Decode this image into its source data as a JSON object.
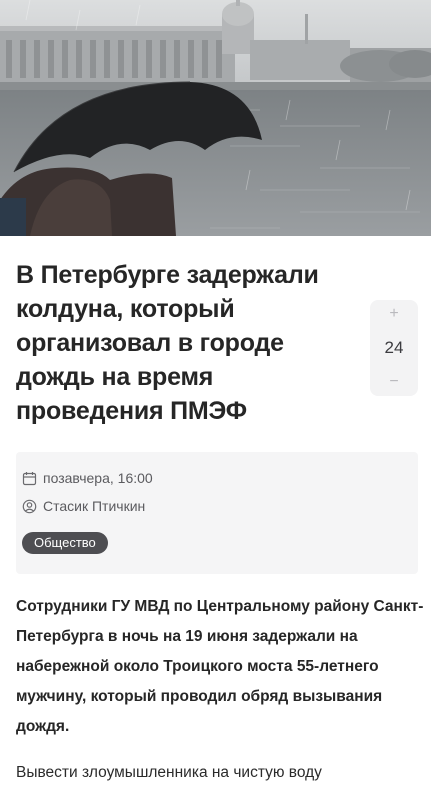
{
  "article": {
    "title": "В Петербурге задержали колдуна, который организовал в городе дождь на время проведения ПМЭФ",
    "date": "позавчера, 16:00",
    "author": "Стасик Птичкин",
    "tag": "Общество",
    "lead": "Сотрудники ГУ МВД по Центральному району Санкт-Петербурга в ночь на 19 июня задержали на набережной около Троицкого моста 55-летнего мужчину, который проводил обряд вызывания дождя.",
    "body_first": "Вывести злоумышленника на чистую воду"
  },
  "vote": {
    "plus": "+",
    "count": "24",
    "minus": "−"
  },
  "icons": {
    "date": "calendar-icon",
    "author": "user-icon"
  },
  "colors": {
    "tag_bg": "#4e4e52",
    "meta_bg": "#f5f5f6",
    "vote_bg": "#f3f3f4"
  }
}
